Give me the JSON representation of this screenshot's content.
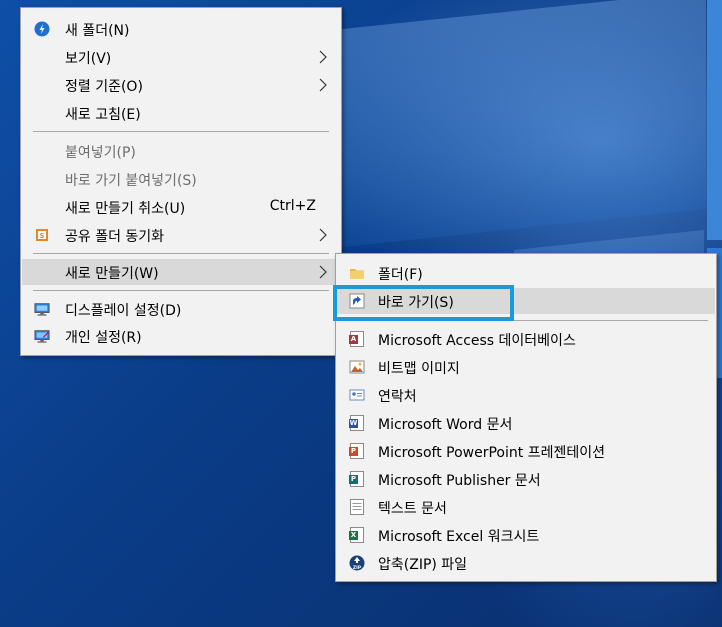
{
  "main_menu": {
    "items": [
      {
        "label": "새 폴더(N)",
        "icon": "new-folder-icon"
      },
      {
        "label": "보기(V)"
      },
      {
        "label": "정렬 기준(O)"
      },
      {
        "label": "새로 고침(E)"
      },
      {
        "label": "붙여넣기(P)"
      },
      {
        "label": "바로 가기 붙여넣기(S)"
      },
      {
        "label": "새로 만들기 취소(U)",
        "shortcut": "Ctrl+Z"
      },
      {
        "label": "공유 폴더 동기화",
        "icon": "sync-shared-folder-icon"
      },
      {
        "label": "새로 만들기(W)"
      },
      {
        "label": "디스플레이 설정(D)",
        "icon": "display-settings-icon"
      },
      {
        "label": "개인 설정(R)",
        "icon": "personalize-icon"
      }
    ]
  },
  "sub_menu": {
    "items": [
      {
        "label": "폴더(F)",
        "icon": "folder-icon"
      },
      {
        "label": "바로 가기(S)",
        "icon": "shortcut-icon"
      },
      {
        "label": "Microsoft Access 데이터베이스",
        "icon": "access-icon"
      },
      {
        "label": "비트맵 이미지",
        "icon": "bitmap-icon"
      },
      {
        "label": "연락처",
        "icon": "contact-icon"
      },
      {
        "label": "Microsoft Word 문서",
        "icon": "word-icon"
      },
      {
        "label": "Microsoft PowerPoint 프레젠테이션",
        "icon": "powerpoint-icon"
      },
      {
        "label": "Microsoft Publisher 문서",
        "icon": "publisher-icon"
      },
      {
        "label": "텍스트 문서",
        "icon": "text-document-icon"
      },
      {
        "label": "Microsoft Excel 워크시트",
        "icon": "excel-icon"
      },
      {
        "label": "압축(ZIP) 파일",
        "icon": "zip-icon"
      }
    ]
  },
  "colors": {
    "menu_bg": "#f2f2f2",
    "hover_bg": "#d9d9d9",
    "disabled_text": "#6d6d6d",
    "highlight_border": "#1b9ad9",
    "desktop_blue": "#0a3f86"
  }
}
